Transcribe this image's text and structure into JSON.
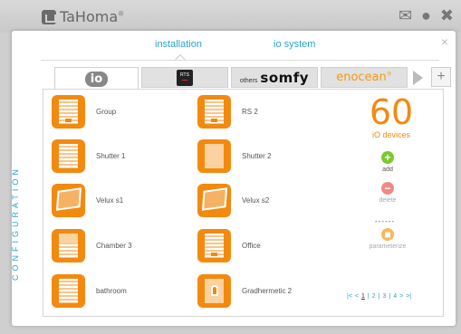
{
  "app": {
    "title": "TaHoma",
    "reg": "®",
    "top_icons": [
      "envelope-icon",
      "user-icon",
      "close-icon"
    ]
  },
  "modal": {
    "close": "×",
    "tabs": [
      {
        "label": "installation",
        "active": true
      },
      {
        "label": "io system",
        "active": false
      }
    ],
    "brand_tabs": {
      "io": "io",
      "rts": "RTS",
      "others_prefix": "others",
      "somfy": "somfy",
      "enocean": "enocean",
      "enocean_reg": "®",
      "next": "next-arrow-icon",
      "add": "+"
    },
    "side_label": "CONFIGURATION",
    "devices": [
      {
        "label": "Group",
        "icon": "shutter-group-icon"
      },
      {
        "label": "RS 2",
        "icon": "shutter-icon"
      },
      {
        "label": "Shutter 1",
        "icon": "shutter-icon"
      },
      {
        "label": "Shutter 2",
        "icon": "shutter-half-icon"
      },
      {
        "label": "Velux s1",
        "icon": "velux-window-icon"
      },
      {
        "label": "Velux s2",
        "icon": "velux-window-icon"
      },
      {
        "label": "Chamber 3",
        "icon": "shutter-half-icon"
      },
      {
        "label": "Office",
        "icon": "shutter-icon"
      },
      {
        "label": "bathroom",
        "icon": "shutter-icon"
      },
      {
        "label": "Gradhermetic 2",
        "icon": "gradhermetic-icon"
      }
    ],
    "count": "60",
    "count_label": "iO devices",
    "actions": {
      "add": "add",
      "delete": "delete",
      "separator": "------",
      "parameterize": "parameterize"
    },
    "pager": {
      "first": "|<",
      "prev": "<",
      "pages": [
        "1",
        "|",
        "2",
        "|",
        "3",
        "|",
        "4"
      ],
      "next": ">",
      "last": ">|"
    },
    "colors": {
      "accent": "#2aa4c9",
      "orange": "#f28a10",
      "add": "#7dc832",
      "delete": "#f08a84",
      "param": "#f8b75c"
    }
  }
}
